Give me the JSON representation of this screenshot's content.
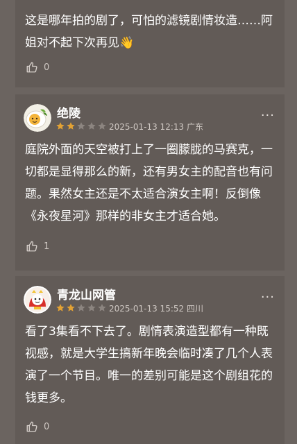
{
  "comments": [
    {
      "text": "这是哪年拍的剧了，可怕的滤镜剧情妆造……阿姐对不起下次再见👋",
      "likes": "0"
    },
    {
      "username": "绝陵",
      "rating": 2,
      "rating_max": 5,
      "date": "2025-01-13 12:13",
      "location": "广东",
      "text": "庭院外面的天空被打上了一圈朦胧的马赛克，一切都是显得那么的新，还有男女主的配音也有问题。果然女主还是不太适合演女主啊！反倒像《永夜星河》那样的非女主才适合她。",
      "likes": "1",
      "more": "···",
      "avatar_icon": "fried-egg-avatar"
    },
    {
      "username": "青龙山网管",
      "rating": 2,
      "rating_max": 5,
      "date": "2025-01-13 15:52",
      "location": "四川",
      "text": "看了3集看不下去了。剧情表演造型都有一种既视感，就是大学生搞新年晚会临时凑了几个人表演了一个节目。唯一的差别可能是这个剧组花的钱更多。",
      "likes": "0",
      "more": "···",
      "avatar_icon": "red-cartoon-avatar"
    }
  ],
  "colors": {
    "background": "#6b6460",
    "card": "#625b57",
    "star_filled": "#e3a234",
    "star_empty": "#8c8580",
    "meta_text": "#cfc8c3"
  },
  "icons": {
    "like": "thumbs-up-icon",
    "more": "more-dots-icon",
    "star": "star-icon"
  }
}
